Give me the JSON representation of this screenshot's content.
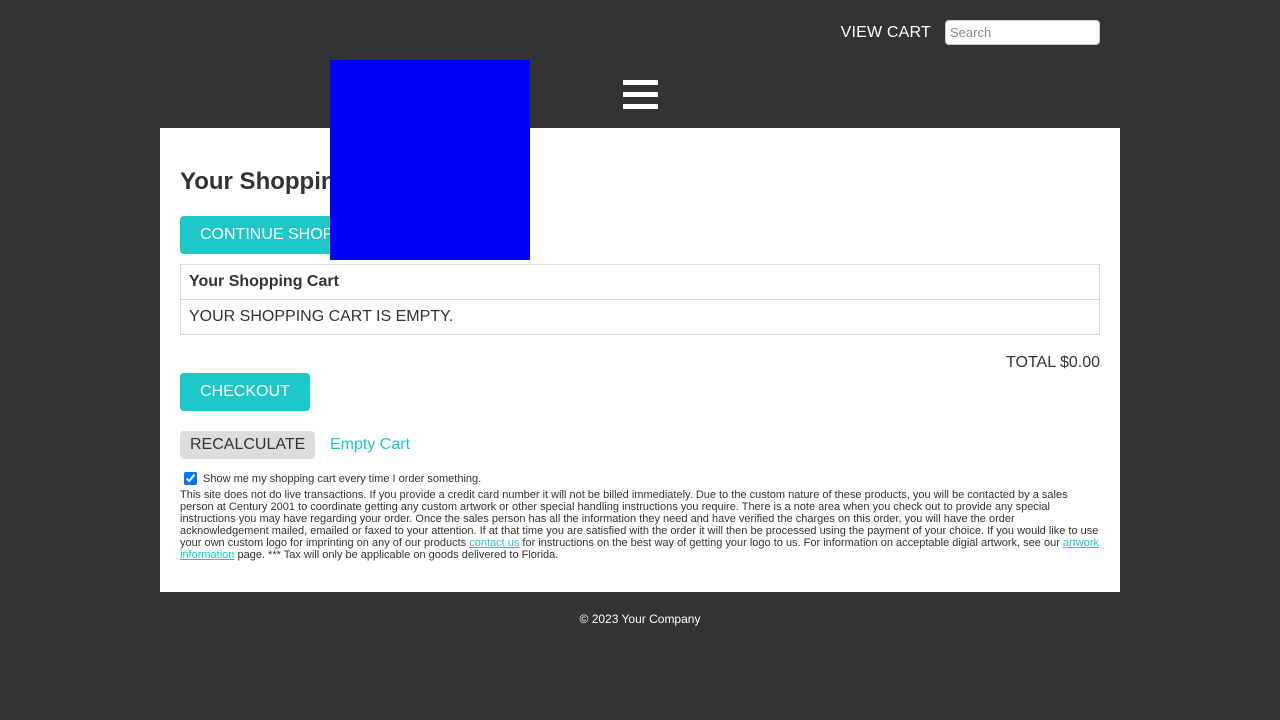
{
  "header": {
    "view_cart_label": "VIEW CART",
    "search_placeholder": "Search"
  },
  "colors": {
    "background": "#333333",
    "accent": "#1ec8c8",
    "logo": "#0000ff",
    "content_bg": "#ffffff"
  },
  "icons": {
    "menu": "hamburger-menu-icon"
  },
  "main": {
    "title": "Your Shopping Cart",
    "continue_label": "CONTINUE SHOPPING",
    "table": {
      "header": "Your Shopping Cart",
      "empty_message": "YOUR SHOPPING CART IS EMPTY."
    },
    "total_label": "TOTAL $0.00",
    "checkout_label": "CHECKOUT",
    "recalculate_label": "RECALCULATE",
    "empty_cart_label": "Empty Cart",
    "show_cart_checkbox_label": "Show me my shopping cart every time I order something.",
    "show_cart_checked": true,
    "disclaimer": {
      "part1": "This site does not do live transactions. If you provide a credit card number it will not be billed immediately. Due to the custom nature of these products, you will be contacted by a sales person at Century 2001 to coordinate getting any custom artwork or other special handling instructions you require. There is a note area when you check out to provide any special instructions you may have regarding your order. Once the sales person has all the information they need and have verified the charges on this order, you will have the order acknowledgement mailed, emailed or faxed to your attention. If at that time you are satisfied with the order it will then be processed using the payment of your choice. If you would like to use your own custom logo for imprinting on any of our products ",
      "link1": "contact us",
      "part2": " for instructions on the best way of getting your logo to us. For information on acceptable digial artwork, see our ",
      "link2": "artwork information",
      "part3": " page. *** Tax will only be applicable on goods delivered to Florida."
    }
  },
  "footer": {
    "copyright": "© 2023 Your Company"
  }
}
